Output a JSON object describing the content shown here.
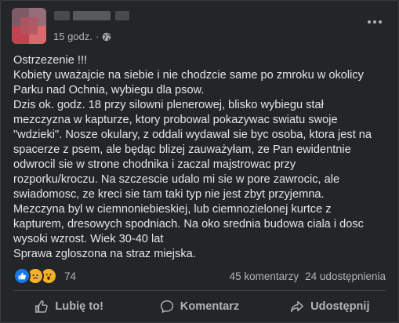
{
  "post": {
    "time": "15 godz.",
    "separator": "·",
    "lines": [
      "Ostrzezenie !!!",
      "Kobiety uważajcie na siebie i nie chodzcie same po zmroku w okolicy",
      "Parku nad Ochnia, wybiegu dla psow.",
      "Dzis ok. godz. 18 przy silowni plenerowej, blisko wybiegu stał",
      "mezczyzna w kapturze, ktory probowal pokazywac swiatu swoje",
      "\"wdzieki\". Nosze okulary, z oddali wydawal sie byc osoba, ktora jest na",
      "spacerze z psem, ale będąc blizej zauważyłam, ze Pan ewidentnie",
      "odwrocil sie w strone chodnika i zaczal majstrowac przy",
      "rozporku/kroczu. Na szczescie udalo mi sie w pore zawrocic, ale",
      "swiadomosc, ze kreci sie tam taki typ nie jest zbyt przyjemna.",
      "Mezczyna byl w ciemnoniebieskiej, lub ciemnozielonej kurtce z",
      "kapturem, dresowych spodniach. Na oko srednia budowa ciala i dosc",
      "wysoki wzrost. Wiek 30-40 lat",
      "Sprawa zgloszona na straz miejska."
    ]
  },
  "stats": {
    "reaction_count": "74",
    "comments": "45 komentarzy",
    "shares": "24 udostępnienia",
    "reactions": [
      "like-reaction",
      "sad-reaction",
      "wow-reaction"
    ]
  },
  "actions": {
    "like": "Lubię to!",
    "comment": "Komentarz",
    "share": "Udostępnij"
  },
  "colors": {
    "background": "#242526",
    "text": "#e4e6eb",
    "muted": "#b0b3b8",
    "like_blue": "#1877f2"
  }
}
